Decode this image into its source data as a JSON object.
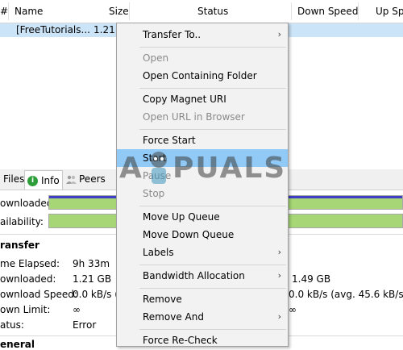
{
  "list": {
    "columns": {
      "hash": "#",
      "name": "Name",
      "size": "Size",
      "status": "Status",
      "down_speed": "Down Speed",
      "up_speed": "Up Sp"
    },
    "rows": [
      {
        "name": "[FreeTutorials...",
        "size": "1.21 G"
      }
    ]
  },
  "tabs": {
    "files": "Files",
    "info": "Info",
    "peers": "Peers"
  },
  "progress": {
    "downloaded_label": "ownloaded:",
    "availability_label": "ailability:",
    "downloaded_fraction": 1.0,
    "availability_fraction": 1.0
  },
  "transfer": {
    "title": "ransfer",
    "time_elapsed_label": "me Elapsed:",
    "time_elapsed_value": "9h 33m",
    "downloaded_label": "ownloaded:",
    "downloaded_value": "1.21 GB",
    "download_speed_label": "ownload Speed:",
    "download_speed_value": "0.0 kB/s (a",
    "down_limit_label": "own Limit:",
    "down_limit_value": "∞",
    "status_label": "atus:",
    "status_value": "Error",
    "right_uploaded_value": "1.49 GB",
    "right_upload_speed_value": "0.0 kB/s (avg. 45.6 kB/s)",
    "right_limit_value": "∞",
    "next_section_title": "eneral"
  },
  "context_menu": {
    "items": [
      {
        "label": "Transfer To..",
        "disabled": false,
        "submenu": true
      },
      {
        "label": "Open",
        "disabled": true,
        "submenu": false
      },
      {
        "label": "Open Containing Folder",
        "disabled": false,
        "submenu": false
      },
      {
        "label": "Copy Magnet URI",
        "disabled": false,
        "submenu": false
      },
      {
        "label": "Open URL in Browser",
        "disabled": true,
        "submenu": false
      },
      {
        "label": "Force Start",
        "disabled": false,
        "submenu": false
      },
      {
        "label": "Start",
        "disabled": false,
        "submenu": false,
        "highlighted": true
      },
      {
        "label": "Pause",
        "disabled": true,
        "submenu": false
      },
      {
        "label": "Stop",
        "disabled": true,
        "submenu": false
      },
      {
        "label": "Move Up Queue",
        "disabled": false,
        "submenu": false
      },
      {
        "label": "Move Down Queue",
        "disabled": false,
        "submenu": false
      },
      {
        "label": "Labels",
        "disabled": false,
        "submenu": true
      },
      {
        "label": "Bandwidth Allocation",
        "disabled": false,
        "submenu": true
      },
      {
        "label": "Remove",
        "disabled": false,
        "submenu": false
      },
      {
        "label": "Remove And",
        "disabled": false,
        "submenu": true
      },
      {
        "label": "Force Re-Check",
        "disabled": false,
        "submenu": false
      }
    ],
    "submenu_arrow": "›"
  },
  "watermark": {
    "text_left": "A",
    "text_right": "PUALS"
  },
  "colors": {
    "selection": "#cce4f7",
    "menu_highlight": "#91c9f7",
    "progress_green": "#a6d676",
    "progress_blue": "#3f3fc6"
  }
}
